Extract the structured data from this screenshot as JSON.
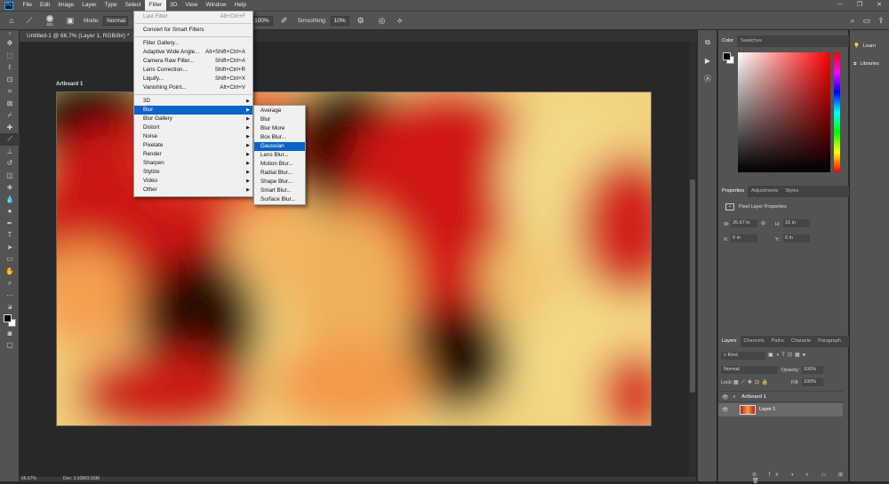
{
  "menubar": {
    "items": [
      "File",
      "Edit",
      "Image",
      "Layer",
      "Type",
      "Select",
      "Filter",
      "3D",
      "View",
      "Window",
      "Help"
    ],
    "active": "Filter"
  },
  "options": {
    "brush_size": "401",
    "mode_label": "Mode:",
    "mode_value": "Normal",
    "flow_value": "100%",
    "smoothing_label": "Smoothing:",
    "smoothing_value": "10%"
  },
  "document": {
    "tab_title": "Untitled-1 @ 66.7% (Layer 1, RGB/8#) *",
    "artboard_label": "Artboard 1",
    "zoom": "66.67%",
    "doc_info": "Doc: 3.93M/3.93M"
  },
  "filter_menu": {
    "last_filter": "Last Filter",
    "last_filter_shortcut": "Alt+Ctrl+F",
    "convert_smart": "Convert for Smart Filters",
    "filter_gallery": "Filter Gallery...",
    "adaptive_wide": "Adaptive Wide Angle...",
    "adaptive_wide_shortcut": "Alt+Shift+Ctrl+A",
    "camera_raw": "Camera Raw Filter...",
    "camera_raw_shortcut": "Shift+Ctrl+A",
    "lens_correction": "Lens Correction...",
    "lens_correction_shortcut": "Shift+Ctrl+R",
    "liquify": "Liquify...",
    "liquify_shortcut": "Shift+Ctrl+X",
    "vanishing_point": "Vanishing Point...",
    "vanishing_point_shortcut": "Alt+Ctrl+V",
    "sub_3d": "3D",
    "sub_blur": "Blur",
    "sub_blur_gallery": "Blur Gallery",
    "sub_distort": "Distort",
    "sub_noise": "Noise",
    "sub_pixelate": "Pixelate",
    "sub_render": "Render",
    "sub_sharpen": "Sharpen",
    "sub_stylize": "Stylize",
    "sub_video": "Video",
    "sub_other": "Other"
  },
  "blur_menu": {
    "items": [
      "Average",
      "Blur",
      "Blur More",
      "Box Blur...",
      "Gaussian Blur...",
      "Lens Blur...",
      "Motion Blur...",
      "Radial Blur...",
      "Shape Blur...",
      "Smart Blur...",
      "Surface Blur..."
    ],
    "highlighted": "Gaussian Blur..."
  },
  "color_panel": {
    "tabs": [
      "Color",
      "Swatches"
    ],
    "foreground": "#000000",
    "background": "#ffffff",
    "hue": "#ff0000"
  },
  "properties_panel": {
    "tabs": [
      "Properties",
      "Adjustments",
      "Styles"
    ],
    "title": "Pixel Layer Properties",
    "w_label": "W:",
    "w_value": "26.67 in",
    "h_label": "H:",
    "h_value": "15 in",
    "x_label": "X:",
    "x_value": "0 in",
    "y_label": "Y:",
    "y_value": "0 in"
  },
  "layers_panel": {
    "tabs": [
      "Layers",
      "Channels",
      "Paths",
      "Characte",
      "Paragraph"
    ],
    "kind_label": "Kind",
    "blend_mode": "Normal",
    "opacity_label": "Opacity:",
    "opacity_value": "100%",
    "lock_label": "Lock:",
    "fill_label": "Fill:",
    "fill_value": "100%",
    "artboard_name": "Artboard 1",
    "layer_name": "Layer 1"
  },
  "right_dock": {
    "learn": "Learn",
    "libraries": "Libraries"
  },
  "colors": {
    "accent": "#0a64c8",
    "chrome": "#535353",
    "canvas_bg": "#282828"
  }
}
